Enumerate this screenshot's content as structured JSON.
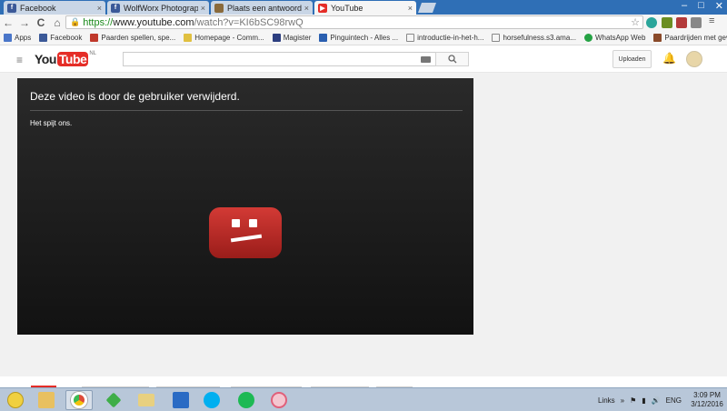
{
  "browser": {
    "tabs": [
      {
        "label": "Facebook",
        "icon": "facebook-icon",
        "color": "#3b5998",
        "active": false
      },
      {
        "label": "WolfWorx Photography",
        "icon": "facebook-icon",
        "color": "#3b5998",
        "active": false
      },
      {
        "label": "Plaats een antwoord • Bol",
        "icon": "forum-icon",
        "color": "#8a6a3b",
        "active": false
      },
      {
        "label": "YouTube",
        "icon": "youtube-icon",
        "color": "#e52d27",
        "active": true
      }
    ],
    "tab_close": "×",
    "window_controls": {
      "minimize": "–",
      "maximize": "□",
      "close": "✕"
    },
    "nav": {
      "back": "←",
      "forward": "→",
      "reload": "C",
      "home": "⌂"
    },
    "url": {
      "scheme": "https://",
      "host": "www.youtube.com",
      "path": "/watch?v=KI6bSC98rwQ"
    },
    "star": "☆",
    "bookmarks": [
      {
        "label": "Apps",
        "icon": "apps-grid-icon",
        "color": "#4a76c9"
      },
      {
        "label": "Facebook",
        "icon": "facebook-icon",
        "color": "#3b5998"
      },
      {
        "label": "Paarden spellen, spe...",
        "icon": "horse-icon",
        "color": "#c0392b"
      },
      {
        "label": "Homepage - Comm...",
        "icon": "homepage-icon",
        "color": "#e0c040"
      },
      {
        "label": "Magister",
        "icon": "magister-icon",
        "color": "#2c3e80"
      },
      {
        "label": "Pinguintech - Alles ...",
        "icon": "pinguintech-icon",
        "color": "#2a5fb0"
      },
      {
        "label": "introductie-in-het-h...",
        "icon": "document-icon",
        "color": "#888888"
      },
      {
        "label": "horsefulness.s3.ama...",
        "icon": "document-icon",
        "color": "#888888"
      },
      {
        "label": "WhatsApp Web",
        "icon": "whatsapp-icon",
        "color": "#25a244"
      },
      {
        "label": "Paardrijden met gev...",
        "icon": "horse-rider-icon",
        "color": "#8a4a2a"
      }
    ]
  },
  "youtube": {
    "logo_you": "You",
    "logo_tube": "Tube",
    "logo_region": "NL",
    "search_placeholder": "",
    "upload_label": "Uploaden",
    "player": {
      "title": "Deze video is door de gebruiker verwijderd.",
      "subtitle": "Het spijt ons."
    }
  },
  "taskbar": {
    "apps": [
      {
        "name": "start-button",
        "color": "#f0d040"
      },
      {
        "name": "file-explorer-icon",
        "color": "#e8c060"
      },
      {
        "name": "chrome-icon",
        "color": "#dd4b39",
        "active": true
      },
      {
        "name": "sims-icon",
        "color": "#3fae49"
      },
      {
        "name": "folder-icon",
        "color": "#e8d080"
      },
      {
        "name": "mail-icon",
        "color": "#2a6bc4"
      },
      {
        "name": "skype-icon",
        "color": "#00aff0"
      },
      {
        "name": "spotify-icon",
        "color": "#1db954"
      },
      {
        "name": "paint-app-icon",
        "color": "#e0607a"
      }
    ],
    "links_label": "Links",
    "language": "ENG",
    "time": "3:09 PM",
    "date": "3/12/2016"
  }
}
